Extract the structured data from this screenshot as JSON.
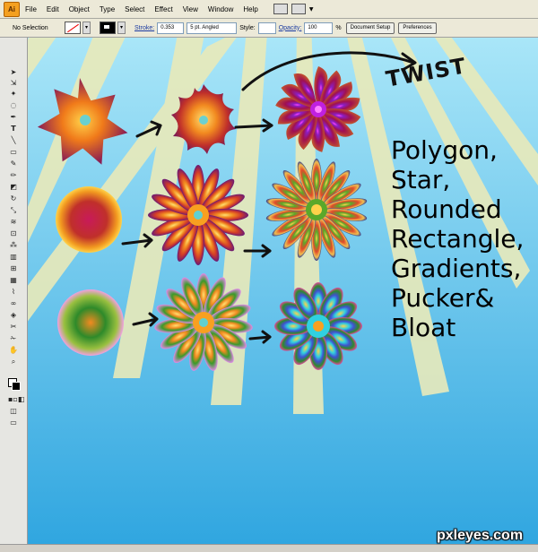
{
  "app": {
    "logo": "Ai",
    "menu": [
      "File",
      "Edit",
      "Object",
      "Type",
      "Select",
      "Effect",
      "View",
      "Window",
      "Help"
    ]
  },
  "control": {
    "selection": "No Selection",
    "stroke_label": "Stroke:",
    "stroke_value": "0.353",
    "brush_value": "5 pt. Angled",
    "style_label": "Style:",
    "opacity_label": "Opacity:",
    "opacity_value": "100",
    "opacity_unit": "%",
    "document_setup": "Document Setup",
    "preferences": "Preferences"
  },
  "artwork": {
    "twist_label": "TWIST",
    "caption_lines": [
      "Polygon,",
      "Star,",
      "Rounded",
      "Rectangle,",
      "Gradients,",
      "Pucker&",
      "Bloat"
    ],
    "colors": {
      "sky_top": "#a9e6f8",
      "sky_bottom": "#30a6e0",
      "rays": "#e9eaba"
    }
  },
  "watermark": "pxleyes.com"
}
